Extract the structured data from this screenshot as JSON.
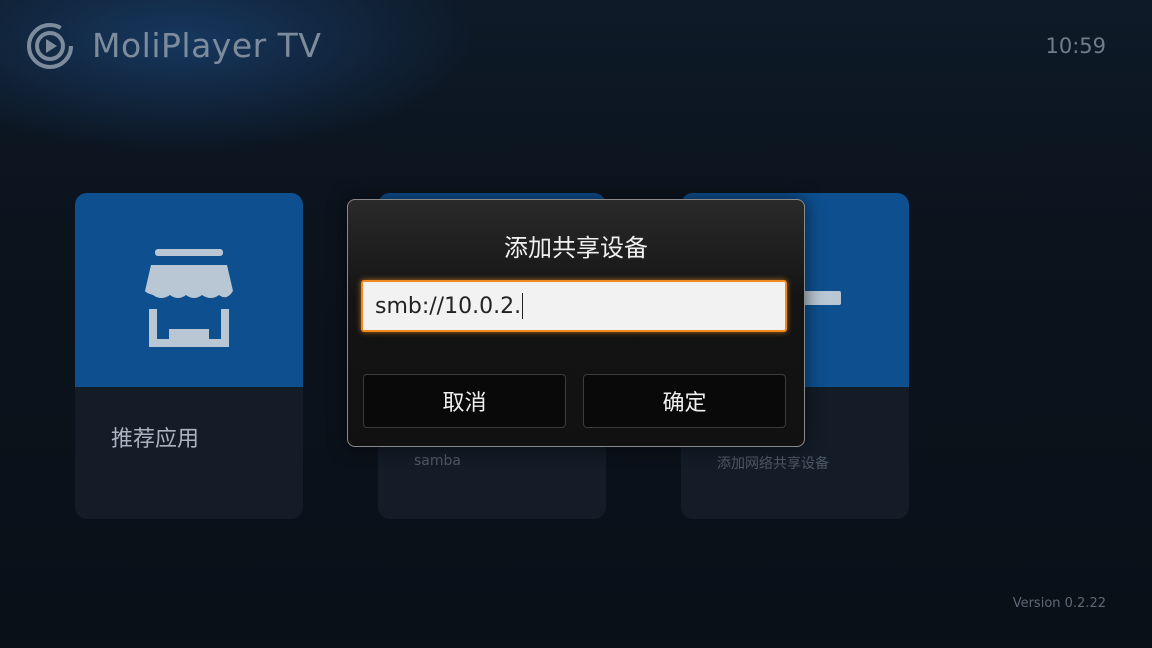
{
  "app": {
    "title": "MoliPlayer TV",
    "logo_icon": "play-disc-icon"
  },
  "status": {
    "time": "10:59",
    "version": "Version 0.2.22"
  },
  "tiles": [
    {
      "label": "推荐应用",
      "sub": "",
      "icon": "store-icon"
    },
    {
      "label": "",
      "sub": "samba",
      "icon": ""
    },
    {
      "label": "",
      "sub": "添加网络共享设备",
      "icon": "minus-icon"
    }
  ],
  "dialog": {
    "title": "添加共享设备",
    "input_value": "smb://10.0.2.",
    "cancel_label": "取消",
    "ok_label": "确定"
  },
  "colors": {
    "accent": "#0d4f8f",
    "focus": "#f08a1c"
  }
}
